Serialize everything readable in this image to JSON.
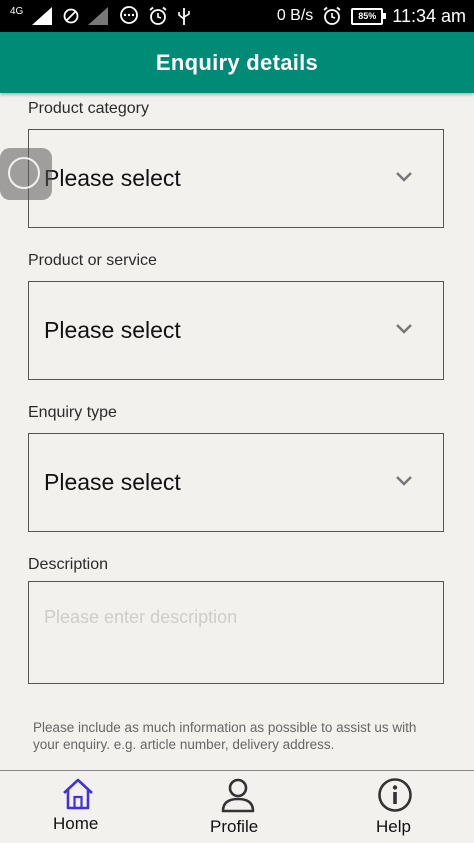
{
  "status_bar": {
    "network": "4G",
    "speed": "0 B/s",
    "battery": "85%",
    "time": "11:34 am"
  },
  "header": {
    "title": "Enquiry details"
  },
  "form": {
    "product_category": {
      "label": "Product category",
      "value": "Please select"
    },
    "product_or_service": {
      "label": "Product or service",
      "value": "Please select"
    },
    "enquiry_type": {
      "label": "Enquiry type",
      "value": "Please select"
    },
    "description": {
      "label": "Description",
      "placeholder": "Please enter description"
    },
    "helper_text": "Please include as much information as possible to assist us with your enquiry. e.g. article number, delivery address."
  },
  "bottom_nav": {
    "items": [
      {
        "label": "Home",
        "icon": "home-icon",
        "active": true
      },
      {
        "label": "Profile",
        "icon": "profile-icon",
        "active": false
      },
      {
        "label": "Help",
        "icon": "info-icon",
        "active": false
      }
    ]
  },
  "colors": {
    "header": "#008b77",
    "background": "#f3f1ee",
    "active_nav": "#3f33d9"
  }
}
